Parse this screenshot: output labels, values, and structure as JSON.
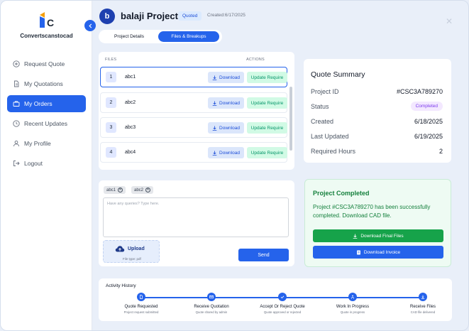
{
  "app": {
    "logo_text": "Convertscanstocad",
    "logo_letters": "SC"
  },
  "sidebar": {
    "items": [
      {
        "label": "Request Quote",
        "icon": "plus-circle-icon"
      },
      {
        "label": "My Quotations",
        "icon": "document-icon"
      },
      {
        "label": "My Orders",
        "icon": "briefcase-icon",
        "active": true
      },
      {
        "label": "Recent Updates",
        "icon": "clock-icon"
      },
      {
        "label": "My Profile",
        "icon": "user-icon"
      },
      {
        "label": "Logout",
        "icon": "logout-icon"
      }
    ]
  },
  "header": {
    "avatar_letter": "b",
    "title": "balaji Project",
    "status_badge": "Quoted",
    "created": "Created:6/17/2025"
  },
  "tabs": [
    {
      "label": "Project Details",
      "active": false
    },
    {
      "label": "Files & Breakups",
      "active": true
    }
  ],
  "files": {
    "col_files": "FILES",
    "col_actions": "ACTIONS",
    "download_label": "Download",
    "update_label": "Update Require",
    "rows": [
      {
        "num": "1",
        "name": "abc1"
      },
      {
        "num": "2",
        "name": "abc2"
      },
      {
        "num": "3",
        "name": "abc3"
      },
      {
        "num": "4",
        "name": "abc4"
      }
    ]
  },
  "query": {
    "chips": [
      "abc1",
      "abc2"
    ],
    "placeholder": "Have any queries? Type here.",
    "upload_label": "Upload",
    "upload_sub": "File type: pdf",
    "send_label": "Send"
  },
  "summary": {
    "title": "Quote Summary",
    "project_id_label": "Project ID",
    "project_id": "#CSC3A789270",
    "status_label": "Status",
    "status": "Completed",
    "created_label": "Created",
    "created": "6/18/2025",
    "updated_label": "Last Updated",
    "updated": "6/19/2025",
    "hours_label": "Required Hours",
    "hours": "2"
  },
  "completed": {
    "title": "Project Completed",
    "text": "Project #CSC3A789270 has been successfully completed. Download CAD file.",
    "download_final": "Download Final Files",
    "download_invoice": "Download Invoice"
  },
  "activity": {
    "title": "Activity History",
    "steps": [
      {
        "label": "Quote Requested",
        "sub": "Project request submitted"
      },
      {
        "label": "Receive Quotation",
        "sub": "Quote shared by admin"
      },
      {
        "label": "Accept Or Reject Quote",
        "sub": "Quote approved or rejected"
      },
      {
        "label": "Work In Progress",
        "sub": "Quote in progress"
      },
      {
        "label": "Receive Files",
        "sub": "CAD file delivered"
      }
    ]
  },
  "colors": {
    "accent": "#2563eb",
    "success": "#16a34a",
    "background": "#e9eff9"
  }
}
